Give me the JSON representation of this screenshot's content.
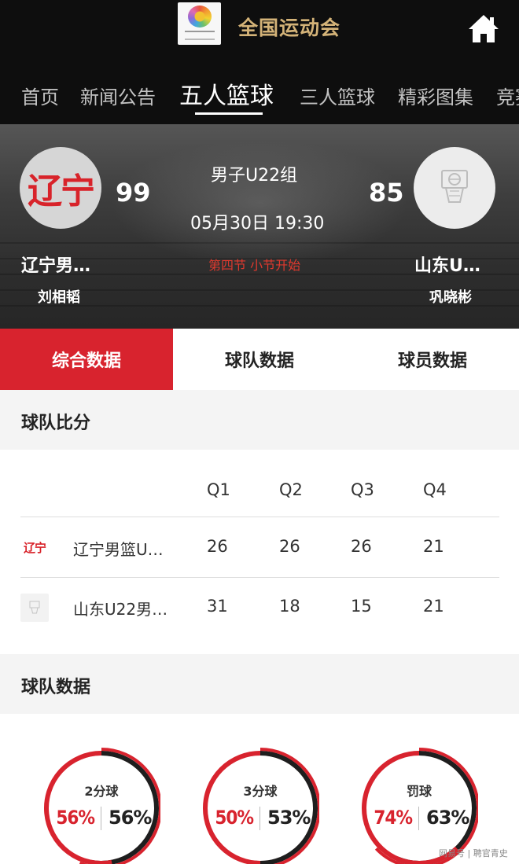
{
  "header": {
    "app_title": "全国运动会",
    "home_icon": "home-icon"
  },
  "nav": {
    "tabs": [
      {
        "label": "首页"
      },
      {
        "label": "新闻公告"
      },
      {
        "label": "五人篮球",
        "active": true
      },
      {
        "label": "三人篮球"
      },
      {
        "label": "精彩图集"
      },
      {
        "label": "竞赛"
      }
    ]
  },
  "match": {
    "group": "男子U22组",
    "datetime": "05月30日 19:30",
    "status": "第四节 小节开始",
    "home": {
      "logo_text": "辽宁",
      "score": "99",
      "name": "辽宁男…",
      "coach": "刘相韬"
    },
    "away": {
      "score": "85",
      "name": "山东U…",
      "coach": "巩晓彬"
    }
  },
  "data_tabs": [
    {
      "label": "综合数据",
      "active": true
    },
    {
      "label": "球队数据"
    },
    {
      "label": "球员数据"
    }
  ],
  "score_section": {
    "title": "球队比分",
    "quarters": [
      "Q1",
      "Q2",
      "Q3",
      "Q4"
    ],
    "rows": [
      {
        "logo_text": "辽宁",
        "name": "辽宁男篮U…",
        "scores": [
          "26",
          "26",
          "26",
          "21"
        ]
      },
      {
        "name": "山东U22男…",
        "scores": [
          "31",
          "18",
          "15",
          "21"
        ]
      }
    ]
  },
  "team_section": {
    "title": "球队数据",
    "gauges": [
      {
        "label": "2分球",
        "home_pct": "56%",
        "away_pct": "56%",
        "home_value": 0.56,
        "away_value": 0.56
      },
      {
        "label": "3分球",
        "home_pct": "50%",
        "away_pct": "53%",
        "home_value": 0.5,
        "away_value": 0.53
      },
      {
        "label": "罚球",
        "home_pct": "74%",
        "away_pct": "63%",
        "home_value": 0.74,
        "away_value": 0.63
      }
    ]
  },
  "watermark": "网易号 | 聘官青史",
  "colors": {
    "accent_red": "#d8232e",
    "header_bg": "#0e0e0e",
    "title_gold": "#d4b378"
  }
}
